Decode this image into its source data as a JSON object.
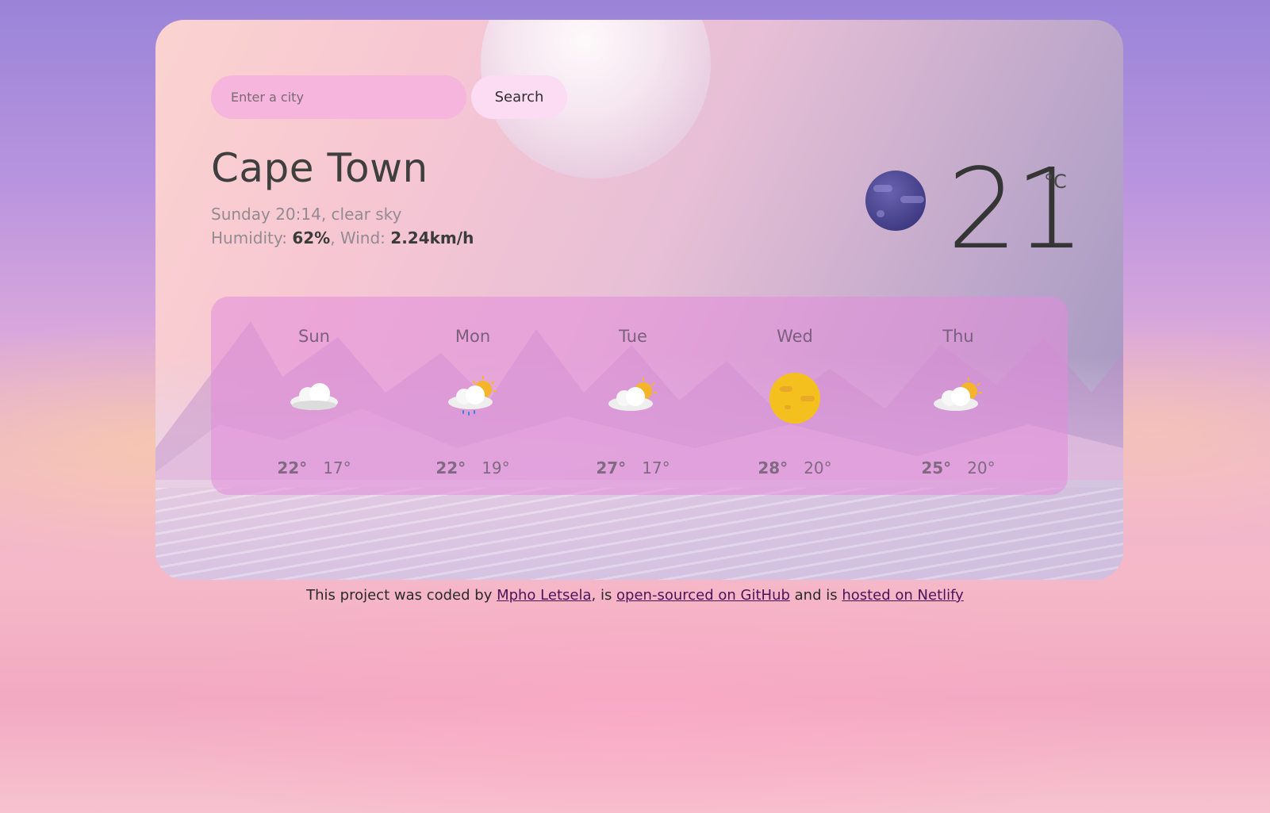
{
  "search": {
    "placeholder": "Enter a city",
    "button_label": "Search"
  },
  "current": {
    "city": "Cape Town",
    "datetime_description": "Sunday 20:14, clear sky",
    "humidity_label": "Humidity: ",
    "humidity_value": "62%",
    "wind_label": ", Wind: ",
    "wind_value": "2.24km/h",
    "temperature": "21",
    "unit": "°C",
    "icon": "clear-sky-night-icon"
  },
  "forecast": [
    {
      "day": "Sun",
      "max": "22°",
      "min": "17°",
      "icon": "cloudy-icon"
    },
    {
      "day": "Mon",
      "max": "22°",
      "min": "19°",
      "icon": "rain-sun-icon"
    },
    {
      "day": "Tue",
      "max": "27°",
      "min": "17°",
      "icon": "partly-cloudy-icon"
    },
    {
      "day": "Wed",
      "max": "28°",
      "min": "20°",
      "icon": "sunny-icon"
    },
    {
      "day": "Thu",
      "max": "25°",
      "min": "20°",
      "icon": "partly-cloudy-icon"
    }
  ],
  "footer": {
    "prefix": "This project was coded by ",
    "author": "Mpho Letsela",
    "middle": ", is ",
    "github": "open-sourced on GitHub",
    "and": " and is ",
    "netlify": "hosted on Netlify"
  },
  "colors": {
    "accent": "#f5b5dc",
    "button": "#fbdcf3",
    "link": "#4b1358",
    "forecast_panel": "#e28cda"
  }
}
